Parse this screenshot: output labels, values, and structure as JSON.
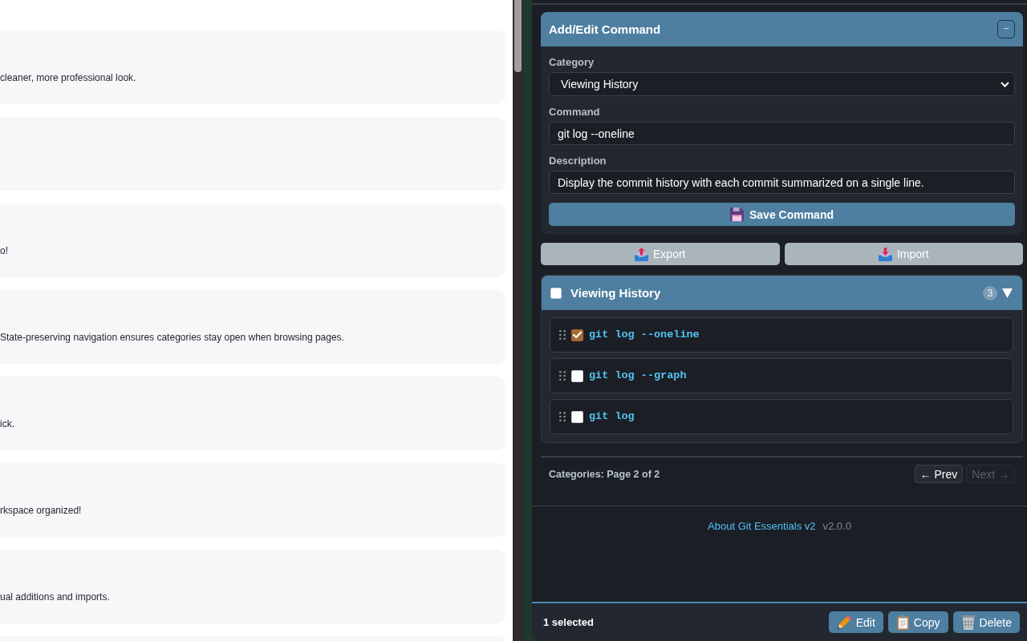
{
  "document": {
    "cards": [
      {
        "kind": "text",
        "text": "cleaner, more professional look."
      },
      {
        "kind": "blank"
      },
      {
        "kind": "text",
        "text": "o!"
      },
      {
        "kind": "text",
        "text": "State-preserving navigation ensures categories stay open when browsing pages."
      },
      {
        "kind": "text",
        "text": "ick."
      },
      {
        "kind": "text",
        "text": "rkspace organized!"
      },
      {
        "kind": "text",
        "text": "ual additions and imports."
      },
      {
        "kind": "blank"
      }
    ]
  },
  "panel": {
    "editor": {
      "title": "Add/Edit Command",
      "collapse_label": "−",
      "fields": [
        {
          "kind": "select",
          "label": "Category",
          "value": "Viewing History"
        },
        {
          "kind": "text",
          "label": "Command",
          "value": "git log --oneline"
        },
        {
          "kind": "text",
          "label": "Description",
          "value": "Display the commit history with each commit summarized on a single line."
        }
      ],
      "save_label": "Save Command"
    },
    "transfer_buttons": [
      {
        "kind": "export",
        "label": "Export"
      },
      {
        "kind": "import",
        "label": "Import"
      }
    ],
    "category": {
      "name": "Viewing History",
      "checked": false,
      "count": "3",
      "expanded": true,
      "commands": [
        {
          "command": "git log --oneline",
          "checked": true
        },
        {
          "command": "git log --graph",
          "checked": false
        },
        {
          "command": "git log",
          "checked": false
        }
      ]
    },
    "pager": {
      "status": "Categories: Page 2 of 2",
      "buttons": [
        {
          "label": "← Prev",
          "disabled": false
        },
        {
          "label": "Next →",
          "disabled": true
        }
      ]
    },
    "about": {
      "link": "About Git Essentials v2",
      "version": "v2.0.0"
    },
    "footer": {
      "selection": "1 selected",
      "actions": [
        {
          "kind": "edit",
          "label": "Edit"
        },
        {
          "kind": "copy",
          "label": "Copy"
        },
        {
          "kind": "delete",
          "label": "Delete"
        }
      ]
    }
  }
}
